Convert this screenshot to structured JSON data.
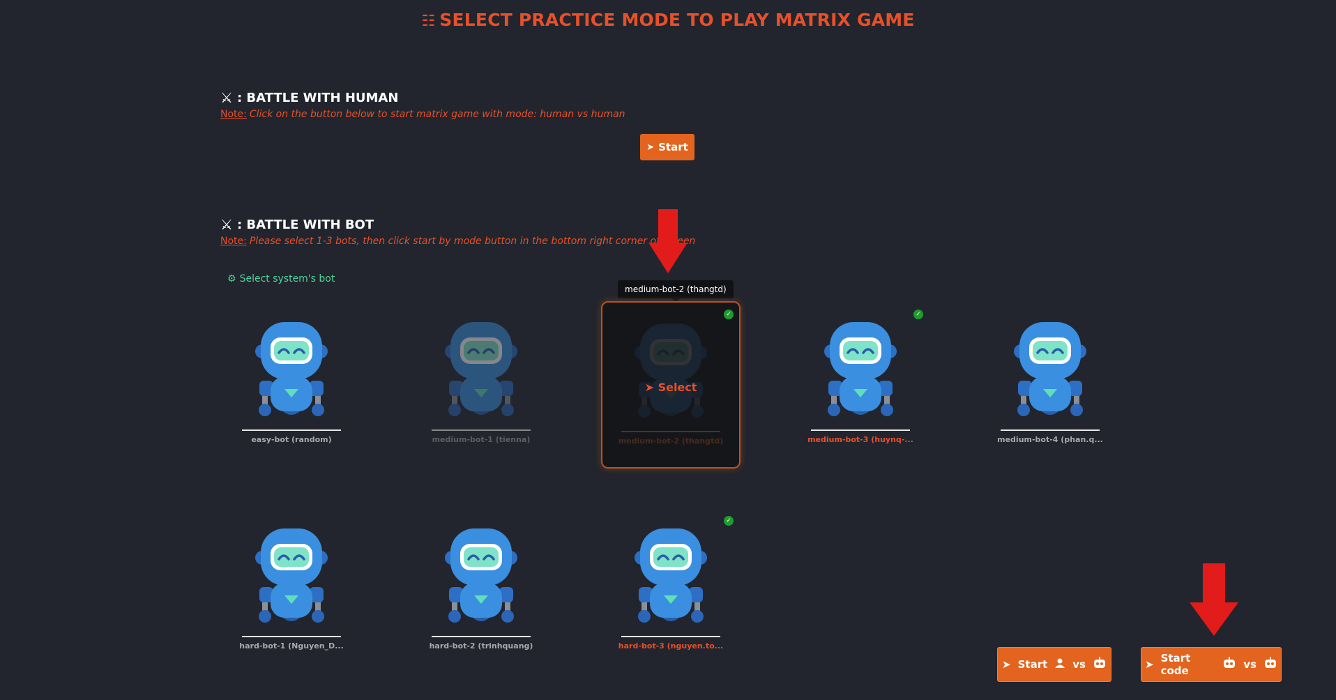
{
  "header": {
    "title": "SELECT PRACTICE MODE TO PLAY MATRIX GAME"
  },
  "human_section": {
    "title": ": BATTLE WITH HUMAN",
    "note_label": "Note:",
    "note_text": "Click on the button below to start matrix game with mode: human vs human",
    "start_label": "Start"
  },
  "bot_section": {
    "title": ": BATTLE WITH BOT",
    "note_label": "Note:",
    "note_text": "Please select 1-3 bots, then click start by mode button in the bottom right corner of screen",
    "select_system_label": "Select system's bot",
    "hover_select_label": "Select",
    "tooltip": "medium-bot-2 (thangtd)",
    "bots": [
      {
        "name": "easy-bot (random)",
        "state": "normal",
        "checked": false
      },
      {
        "name": "medium-bot-1 (tienna)",
        "state": "dim",
        "checked": false
      },
      {
        "name": "medium-bot-2 (thangtd)",
        "state": "hovered",
        "checked": true
      },
      {
        "name": "medium-bot-3 (huynq-...",
        "state": "chosen",
        "checked": true
      },
      {
        "name": "medium-bot-4 (phan.q...",
        "state": "normal",
        "checked": false
      },
      {
        "name": "hard-bot-1 (Nguyen_D...",
        "state": "normal",
        "checked": false
      },
      {
        "name": "hard-bot-2 (trinhquang)",
        "state": "normal",
        "checked": false
      },
      {
        "name": "hard-bot-3 (nguyen.to...",
        "state": "chosen",
        "checked": true
      }
    ]
  },
  "mode_buttons": {
    "start_label": "Start",
    "vs_label": "vs",
    "start_code_label": "Start code"
  },
  "colors": {
    "accent": "#e2641f",
    "title": "#e8502a",
    "system": "#4fd39a",
    "background": "#22252d"
  }
}
